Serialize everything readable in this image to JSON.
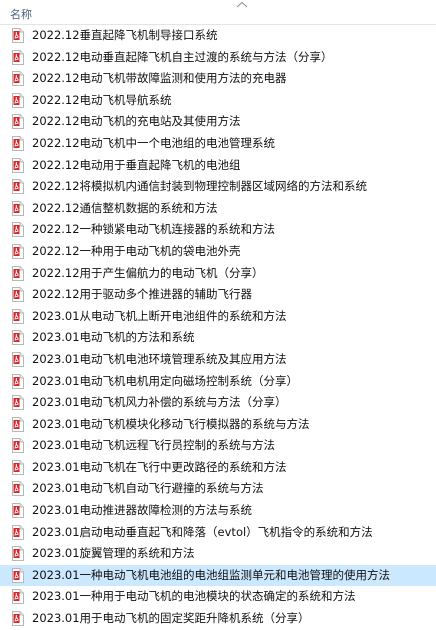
{
  "header": {
    "name_column": "名称"
  },
  "files": [
    "2022.12垂直起降飞机制导接口系统",
    "2022.12电动垂直起降飞机自主过渡的系统与方法（分享）",
    "2022.12电动飞机带故障监测和使用方法的充电器",
    "2022.12电动飞机导航系统",
    "2022.12电动飞机的充电站及其使用方法",
    "2022.12电动飞机中一个电池组的电池管理系统",
    "2022.12电动用于垂直起降飞机的电池组",
    "2022.12将模拟机内通信封装到物理控制器区域网络的方法和系统",
    "2022.12通信整机数据的系统和方法",
    "2022.12一种锁紧电动飞机连接器的系统和方法",
    "2022.12一种用于电动飞机的袋电池外壳",
    "2022.12用于产生偏航力的电动飞机（分享）",
    "2022.12用于驱动多个推进器的辅助飞行器",
    "2023.01从电动飞机上断开电池组件的系统和方法",
    "2023.01电动飞机的方法和系统",
    "2023.01电动飞机电池环境管理系统及其应用方法",
    "2023.01电动飞机电机用定向磁场控制系统（分享）",
    "2023.01电动飞机风力补偿的系统与方法（分享）",
    "2023.01电动飞机模块化移动飞行模拟器的系统与方法",
    "2023.01电动飞机远程飞行员控制的系统与方法",
    "2023.01电动飞机在飞行中更改路径的系统和方法",
    "2023.01电动飞机自动飞行避撞的系统与方法",
    "2023.01电动推进器故障检测的方法与系统",
    "2023.01启动电动垂直起飞和降落（evtol）飞机指令的系统和方法",
    "2023.01旋翼管理的系统和方法",
    "2023.01一种电动飞机电池组的电池组监测单元和电池管理的使用方法",
    "2023.01一种用于电动飞机的电池模块的状态确定的系统和方法",
    "2023.01用于电动飞机的固定奖距升降机系统（分享）"
  ],
  "selected_index": 25,
  "file_icon": "pdf-file-icon",
  "colors": {
    "selected_row": "#cce8ff",
    "pdf_red": "#d9262a",
    "header_text": "#4c607a"
  }
}
